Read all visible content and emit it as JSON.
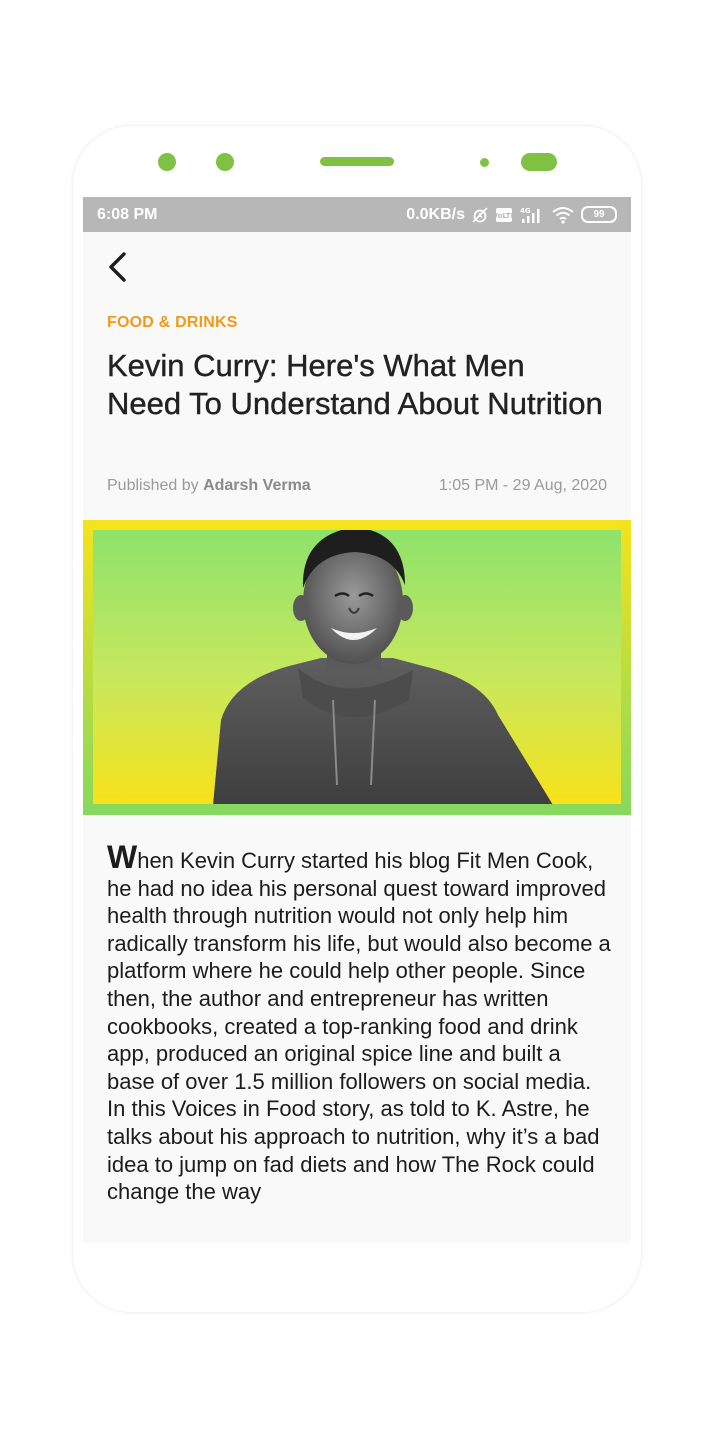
{
  "status_bar": {
    "time": "6:08 PM",
    "net_speed": "0.0KB/s",
    "battery": "99",
    "icons": [
      "alarm-off-icon",
      "volte-icon",
      "signal-4g-icon",
      "wifi-icon",
      "battery-icon"
    ]
  },
  "article": {
    "category": "FOOD & DRINKS",
    "title": "Kevin Curry: Here's What Men Need To Understand About Nutrition",
    "published_prefix": "Published by",
    "author": "Adarsh Verma",
    "datetime": "1:05 PM - 29 Aug, 2020",
    "body_dropcap": "W",
    "body_rest": "hen Kevin Curry started his blog Fit Men Cook, he had no idea his personal quest toward improved health through nutrition would not only help him radically transform his life, but would also become a platform where he could help other people. Since then, the author and entrepreneur has written cookbooks, created a top-ranking food and drink app, produced an original spice line and built a base of over 1.5 million followers on social media. In this Voices in Food story, as told to K. Astre, he talks about his approach to nutrition, why it’s a bad idea to jump on fad diets and how The Rock could change the way"
  },
  "colors": {
    "accent_green": "#7fc143",
    "category_orange": "#f09a1a",
    "status_bar_gray": "#b7b7b7",
    "hero_yellow": "#f5e31b",
    "hero_green": "#8ee26b"
  }
}
